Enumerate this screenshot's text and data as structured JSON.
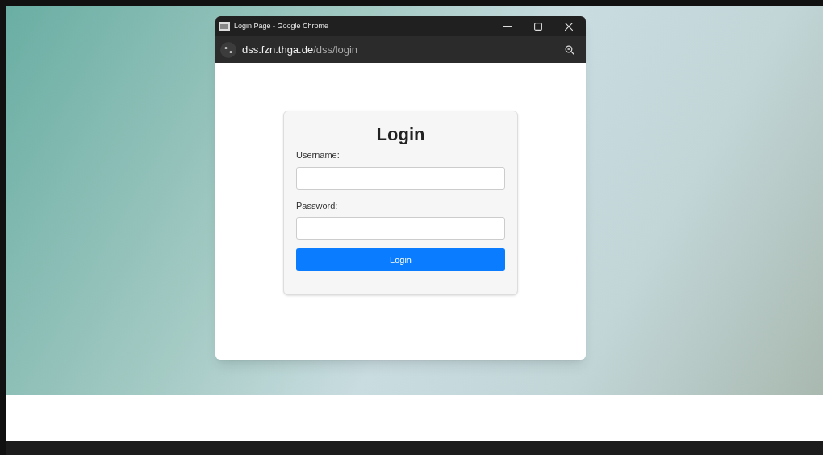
{
  "window": {
    "title": "Login Page - Google Chrome",
    "url_host": "dss.fzn.thga.de",
    "url_path": "/dss/login"
  },
  "form": {
    "heading": "Login",
    "fields": [
      {
        "label": "Username:"
      },
      {
        "label": "Password:"
      }
    ],
    "button": "Login"
  }
}
